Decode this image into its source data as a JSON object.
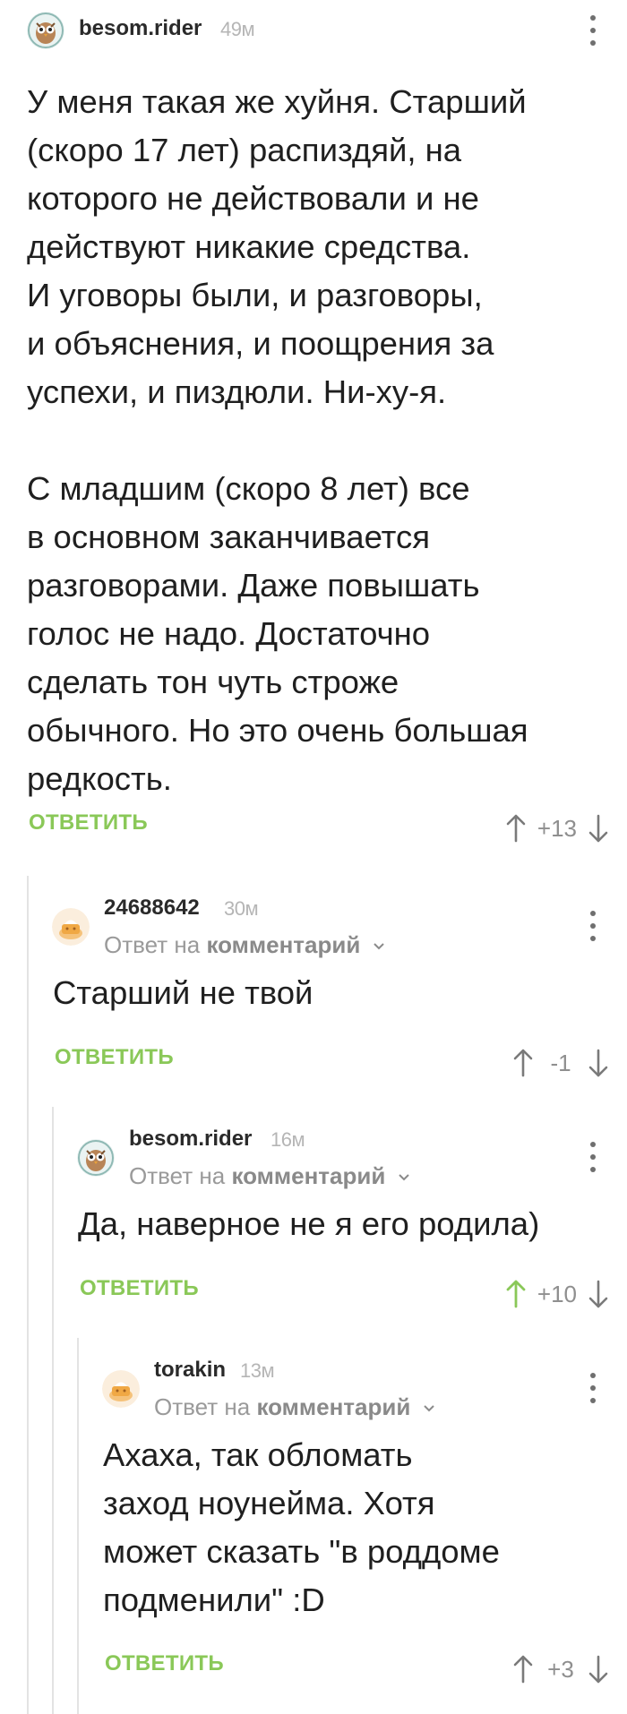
{
  "comments": [
    {
      "username": "besom.rider",
      "time": "49м",
      "text": "У меня такая же хуйня. Старший\n(скоро 17 лет) распиздяй, на\nкоторого не действовали и не\nдействуют никакие средства.\nИ уговоры были, и разговоры,\nи объяснения, и поощрения за\nуспехи, и пиздюли. Ни-ху-я.\n\nС младшим (скоро 8 лет) все\nв основном заканчивается\nразговорами. Даже повышать\nголос не надо. Достаточно\nсделать тон чуть строже\nобычного. Но это очень большая\nредкость.",
      "reply_label": "ОТВЕТИТЬ",
      "score": "+13",
      "upvoted": false
    },
    {
      "username": "24688642",
      "time": "30м",
      "reply_prefix": "Ответ на",
      "reply_target": "комментарий",
      "text": "Старший не твой",
      "reply_label": "ОТВЕТИТЬ",
      "score": "-1",
      "upvoted": false
    },
    {
      "username": "besom.rider",
      "time": "16м",
      "reply_prefix": "Ответ на",
      "reply_target": "комментарий",
      "text": "Да, наверное не я его родила)",
      "reply_label": "ОТВЕТИТЬ",
      "score": "+10",
      "upvoted": true
    },
    {
      "username": "torakin",
      "time": "13м",
      "reply_prefix": "Ответ на",
      "reply_target": "комментарий",
      "text": "Ахаха, так обломать\nзаход ноунейма. Хотя\nможет сказать \"в роддоме\nподменили\" :D",
      "reply_label": "ОТВЕТИТЬ",
      "score": "+3",
      "upvoted": false
    }
  ],
  "colors": {
    "accent_green": "#8ac858",
    "muted_grey": "#9a9a9a",
    "thread_line": "#e3e3e3"
  },
  "icons": {
    "more": "more-vertical-icon",
    "up": "arrow-up-icon",
    "down": "arrow-down-icon",
    "chevron": "chevron-down-icon",
    "avatar_user": "owl-avatar-icon",
    "avatar_anon": "default-avatar-icon"
  }
}
